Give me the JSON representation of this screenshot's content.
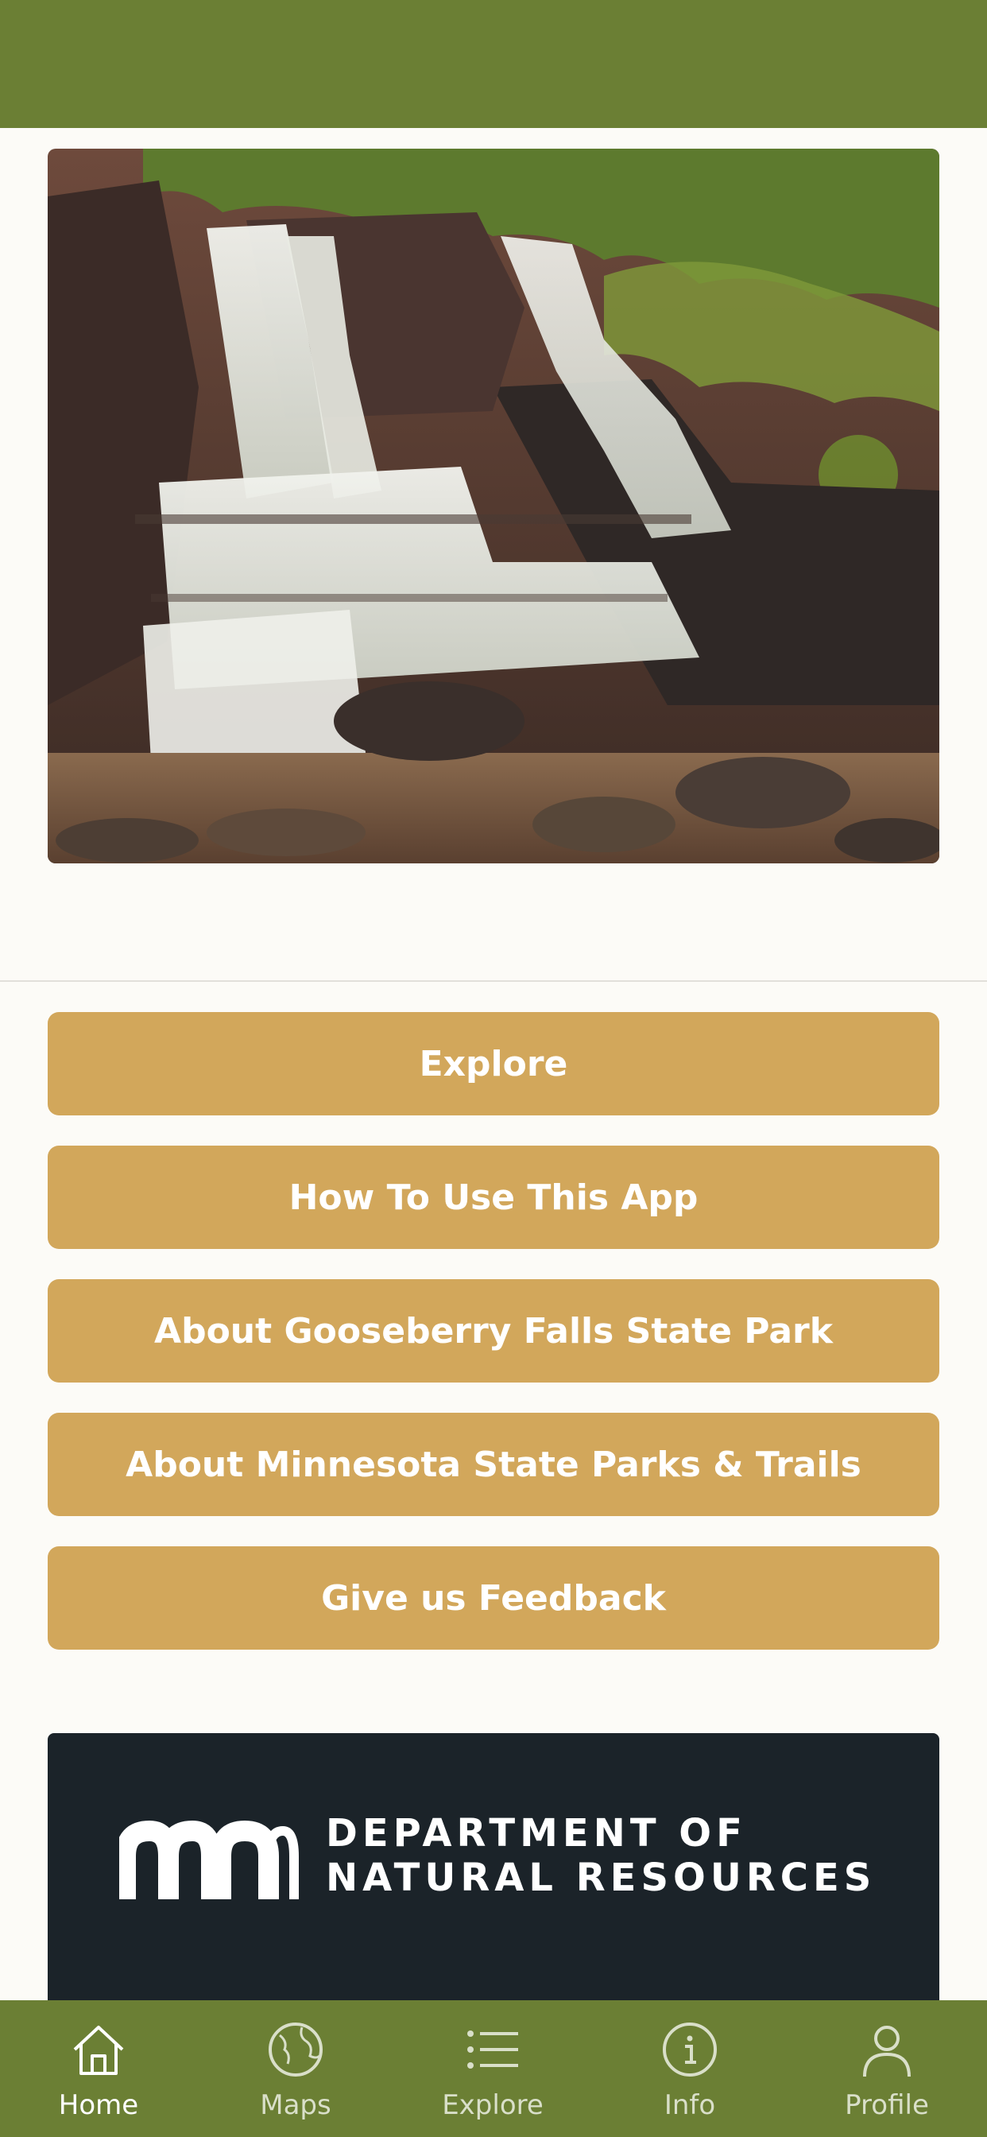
{
  "hero": {
    "alt": "Gooseberry Falls waterfall"
  },
  "buttons": [
    {
      "label": "Explore"
    },
    {
      "label": "How To Use This App"
    },
    {
      "label": "About Gooseberry Falls State Park"
    },
    {
      "label": "About Minnesota State Parks & Trails"
    },
    {
      "label": "Give us Feedback"
    }
  ],
  "dnr": {
    "line1": "DEPARTMENT OF",
    "line2": "NATURAL RESOURCES"
  },
  "tabs": [
    {
      "label": "Home",
      "icon": "home-icon"
    },
    {
      "label": "Maps",
      "icon": "globe-icon"
    },
    {
      "label": "Explore",
      "icon": "list-icon"
    },
    {
      "label": "Info",
      "icon": "info-icon"
    },
    {
      "label": "Profile",
      "icon": "profile-icon"
    }
  ],
  "colors": {
    "header": "#6b7f34",
    "button": "#d2a75b",
    "background": "#fcfbf7",
    "dnr_banner": "#1b2329"
  }
}
